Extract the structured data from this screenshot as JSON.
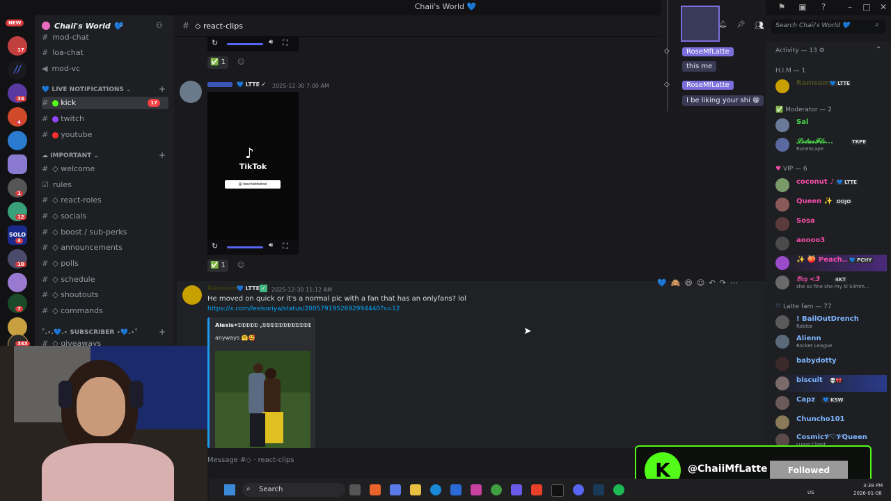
{
  "window": {
    "title": "Chaii's World 💙"
  },
  "server": {
    "name": "Chaii's World 💙",
    "new_badge": "NEW",
    "rail_badges": [
      "17",
      "34",
      "4",
      "1",
      "12",
      "4",
      "10",
      "7",
      "343"
    ]
  },
  "channels": {
    "top": [
      "mod-chat",
      "loa-chat",
      "mod-vc"
    ],
    "live_category": "LIVE NOTIFICATIONS",
    "live": [
      {
        "name": "kick",
        "badge": "17"
      },
      {
        "name": "twitch"
      },
      {
        "name": "youtube"
      }
    ],
    "important_category": "IMPORTANT",
    "important": [
      "welcome",
      "rules",
      "react-roles",
      "socials",
      "boost / sub-perks",
      "announcements",
      "polls",
      "schedule",
      "shoutouts",
      "commands"
    ],
    "subscriber_category": "˚.⋆.💙.⋆ SUBSCRIBER ⋆💙.⋆˚",
    "subscriber_first": "giveaways"
  },
  "header": {
    "channel": "◇ react-clips",
    "search_placeholder": "Search Chaii's World 💙"
  },
  "messages": [
    {
      "role_tag": "LTTE",
      "time": "2025-12-30 7:00 AM",
      "video_brand": "TikTok",
      "video_handle": "@ loochiethetoo",
      "reaction_count": "1"
    },
    {
      "author": "Ramsom",
      "role_tag": "LTTE",
      "time": "2025-12-30 11:12 AM",
      "text": "He moved on quick or it's a normal pic with a fan that has an onlyfans? lol",
      "link": "https://x.com/lexisoriya/status/2005791952692994440?s=12",
      "embed_author": "Alexis•𝔇𝔇𝔇𝔇𝔇 ,𝔇𝔇𝔇𝔇𝔇𝔇𝔇𝔇𝔇𝔇𝔇𝔇...",
      "embed_text": "anyways 🤗🥰"
    }
  ],
  "top_reaction_count": "1",
  "message_placeholder": "Message #◇ · react-clips",
  "thread": [
    {
      "author": "RoseMfLatte",
      "text": "this me"
    },
    {
      "author": "RoseMfLatte",
      "text": "I be liking your shi 😁"
    }
  ],
  "members": {
    "activity": "Activity — 13",
    "groups": [
      {
        "title": "H.I.M — 1",
        "members": [
          {
            "name": "Ramsom",
            "tag": "LTTE",
            "color": "#c8a000"
          }
        ]
      },
      {
        "title": "Moderator — 2",
        "members": [
          {
            "name": "Sal",
            "color": "#4ad94a"
          },
          {
            "name": "𝓛𝓸𝓽𝓾𝓼𝓕𝓵𝓸...",
            "tag": "TRPE",
            "sub": "RuneScape",
            "color": "#4ad94a"
          }
        ]
      },
      {
        "title": "VIP — 6",
        "members": [
          {
            "name": "coconut ♪",
            "tag": "LTTE",
            "color": "#f24ea8"
          },
          {
            "name": "Queen ✨",
            "tag": "DOJO",
            "color": "#f24ea8"
          },
          {
            "name": "Sosa",
            "color": "#f24ea8"
          },
          {
            "name": "aoooo3",
            "color": "#f24ea8"
          },
          {
            "name": "✨ 🍑 Peach...",
            "tag": "PCHY",
            "color": "#f24ea8"
          },
          {
            "name": "𝔅𝔯𝔶 <3",
            "tag": "4KT",
            "sub": "she so fine she my lil Slimm...",
            "color": "#f24ea8"
          }
        ]
      },
      {
        "title": "Latte fam — 77",
        "members": [
          {
            "name": "! BailOutDrench",
            "sub": "Roblox",
            "color": "#7eb6ff"
          },
          {
            "name": "Alienn",
            "sub": "Rocket League",
            "color": "#7eb6ff"
          },
          {
            "name": "babydotty",
            "color": "#7eb6ff"
          },
          {
            "name": "biscuit",
            "tag": "💀🎀",
            "color": "#7eb6ff"
          },
          {
            "name": "Capz",
            "tag": "KSW",
            "color": "#7eb6ff"
          },
          {
            "name": "Chuncho101",
            "color": "#7eb6ff"
          },
          {
            "name": "Cosmic𝒱♡𝒱Queen",
            "sub": "Lunar Client",
            "color": "#7eb6ff"
          }
        ]
      }
    ]
  },
  "follow": {
    "handle": "@ChaiiMfLatte",
    "button": "Followed",
    "logo": "K"
  },
  "taskbar": {
    "search": "Search",
    "time": "3:38 PM",
    "date": "2026-01-08",
    "lang": "US"
  }
}
